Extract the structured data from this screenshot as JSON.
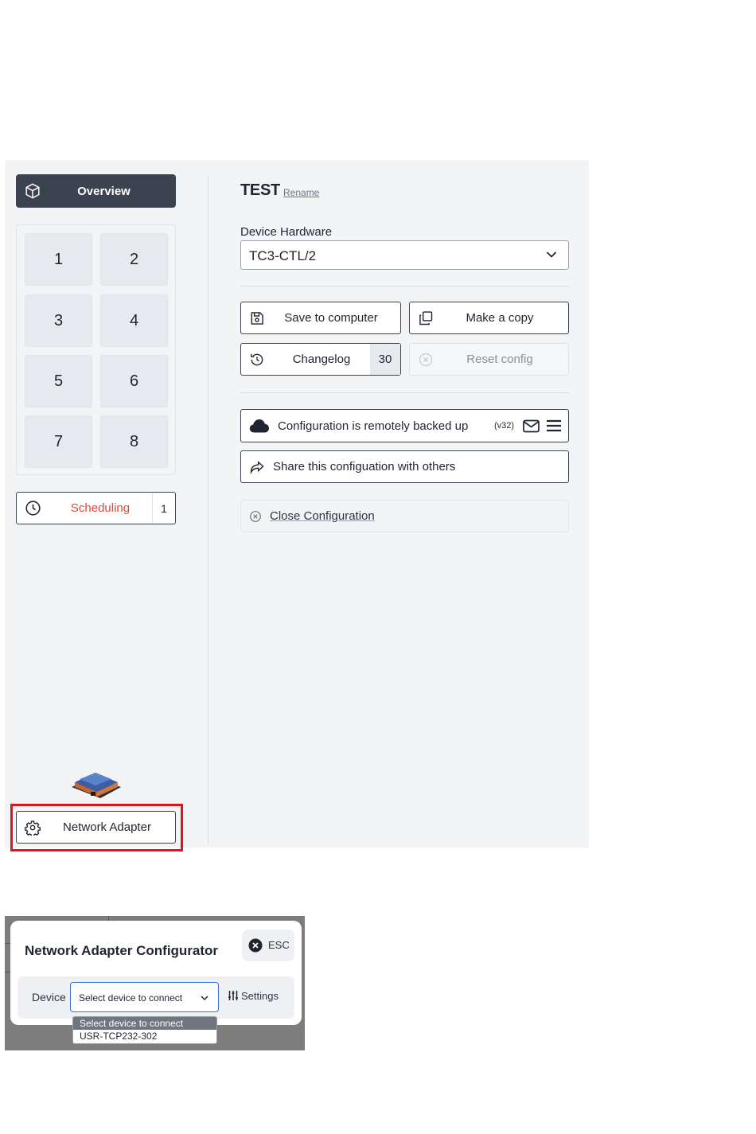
{
  "sidebar": {
    "overview_label": "Overview",
    "tiles": [
      "1",
      "2",
      "3",
      "4",
      "5",
      "6",
      "7",
      "8"
    ],
    "scheduling": {
      "label": "Scheduling",
      "count": "1"
    },
    "network_adapter_label": "Network Adapter"
  },
  "config": {
    "title": "TEST",
    "rename_label": "Rename",
    "hardware_label": "Device Hardware",
    "hardware_value": "TC3-CTL/2",
    "save_label": "Save to computer",
    "copy_label": "Make a copy",
    "changelog_label": "Changelog",
    "changelog_count": "30",
    "reset_label": "Reset config",
    "backup_label": "Configuration is remotely backed up",
    "backup_version": "(v32)",
    "share_label": "Share this configuation with others",
    "close_label": "Close Configuration"
  },
  "dialog": {
    "title": "Network Adapter Configurator",
    "esc_label": "ESC",
    "device_label": "Device",
    "device_select_value": "Select device to connect",
    "settings_label": "Settings",
    "options": [
      "Select device to connect",
      "USR-TCP232-302"
    ]
  },
  "colors": {
    "accent_dark": "#3b4250",
    "scheduling_text": "#e2493b",
    "highlight": "#e0141b",
    "focus_blue": "#3a6fd8"
  }
}
